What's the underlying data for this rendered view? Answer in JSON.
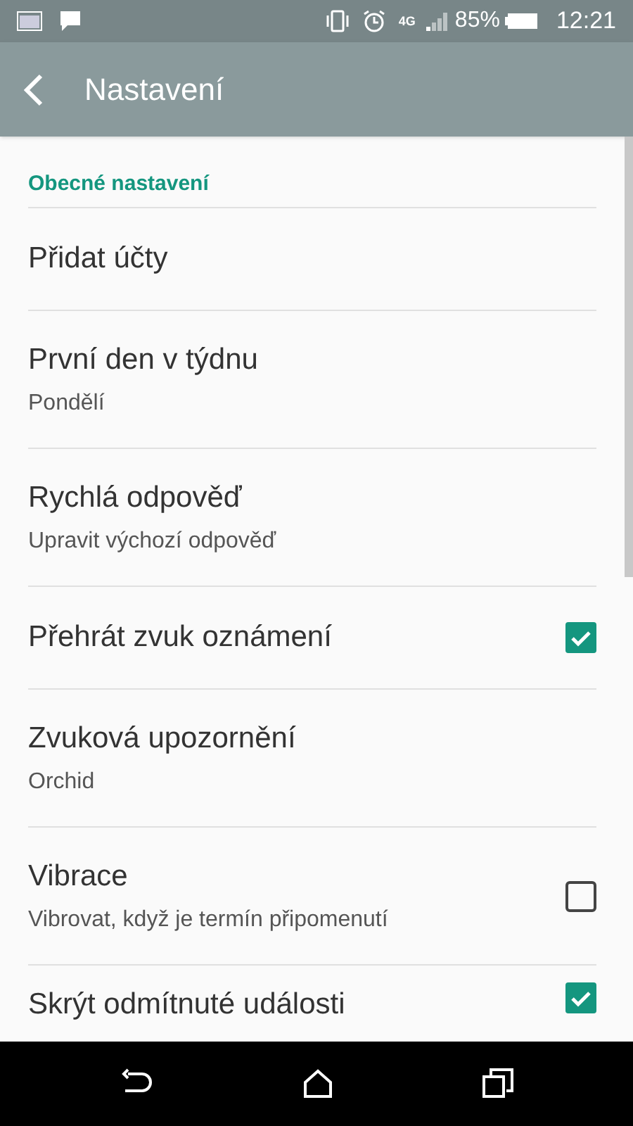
{
  "status_bar": {
    "network": "4G",
    "battery": "85%",
    "time": "12:21"
  },
  "toolbar": {
    "title": "Nastavení"
  },
  "section": {
    "title": "Obecné nastavení"
  },
  "items": [
    {
      "kind": "text",
      "title": "Přidat účty"
    },
    {
      "kind": "text",
      "title": "První den v týdnu",
      "subtitle": "Pondělí"
    },
    {
      "kind": "text",
      "title": "Rychlá odpověď",
      "subtitle": "Upravit výchozí odpověď"
    },
    {
      "kind": "checkbox",
      "title": "Přehrát zvuk oznámení",
      "checked": true
    },
    {
      "kind": "text",
      "title": "Zvuková upozornění",
      "subtitle": "Orchid"
    },
    {
      "kind": "checkbox",
      "title": "Vibrace",
      "subtitle": "Vibrovat, když je termín připomenutí",
      "checked": false
    },
    {
      "kind": "checkbox",
      "title": "Skrýt odmítnuté události",
      "checked": true
    }
  ]
}
